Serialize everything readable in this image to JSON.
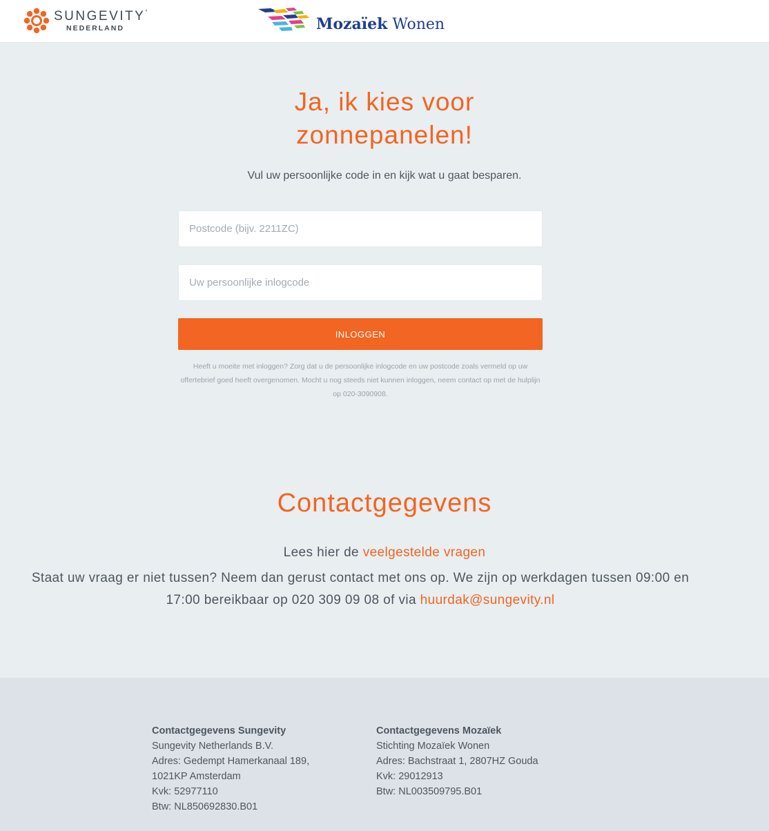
{
  "header": {
    "sungevity_logo": {
      "name": "SUNGEVITY",
      "sub": "NEDERLAND"
    },
    "mozaiek_logo": {
      "brand": "Mozaïek",
      "suffix": "Wonen"
    }
  },
  "hero": {
    "title_line1": "Ja, ik kies voor",
    "title_line2": "zonnepanelen!",
    "subtitle": "Vul uw persoonlijke code in en kijk wat u gaat besparen."
  },
  "form": {
    "postcode_placeholder": "Postcode (bijv. 2211ZC)",
    "code_placeholder": "Uw persoonlijke inlogcode",
    "login_label": "INLOGGEN",
    "help": "Heeft u moeite met inloggen? Zorg dat u de persoonlijke inlogcode en uw postcode zoals vermeld op uw offertebrief goed heeft overgenomen. Mocht u nog steeds niet kunnen inloggen, neem contact op met de hulplijn op 020-3090908."
  },
  "contact": {
    "title": "Contactgegevens",
    "faq_prefix": "Lees hier de ",
    "faq_link": "veelgestelde vragen",
    "body_text": "Staat uw vraag er niet tussen? Neem dan gerust contact met ons op. We zijn op werkdagen tussen 09:00 en 17:00 bereikbaar op 020 309 09 08 of via ",
    "email_link": "huurdak@sungevity.nl"
  },
  "footer": {
    "sungevity": {
      "heading": "Contactgegevens Sungevity",
      "company": "Sungevity Netherlands B.V.",
      "address": "Adres: Gedempt Hamerkanaal 189, 1021KP Amsterdam",
      "kvk": "Kvk: 52977110",
      "btw": "Btw: NL850692830.B01"
    },
    "mozaiek": {
      "heading": "Contactgegevens Mozaïek",
      "company": "Stichting Mozaïek Wonen",
      "address": "Adres: Bachstraat 1, 2807HZ Gouda",
      "kvk": "Kvk: 29012913",
      "btw": "Btw: NL003509795.B01"
    }
  },
  "colors": {
    "accent": "#f26522",
    "page_bg": "#e9eef0",
    "footer_bg": "#dde2e8",
    "text": "#4d5660",
    "mozaiek_blue": "#1f3f8f"
  }
}
